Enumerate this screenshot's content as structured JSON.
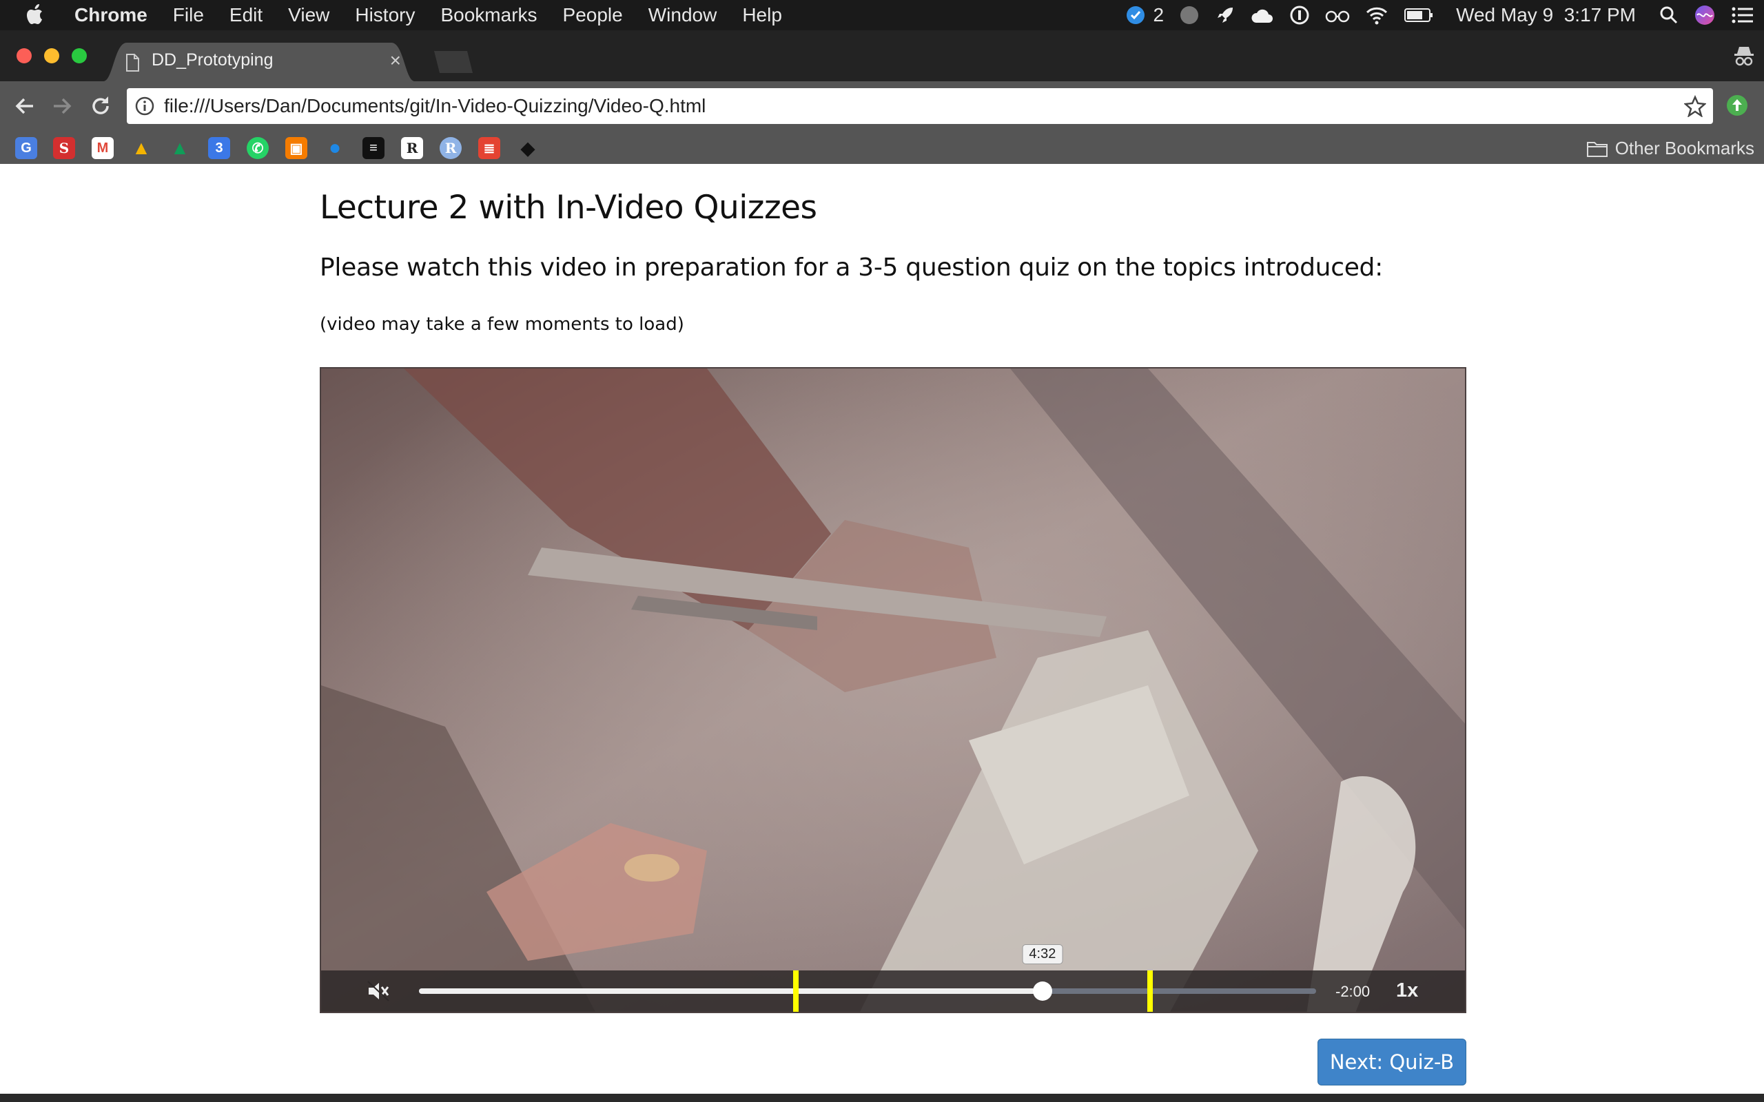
{
  "menubar": {
    "app_name": "Chrome",
    "menus": [
      "File",
      "Edit",
      "View",
      "History",
      "Bookmarks",
      "People",
      "Window",
      "Help"
    ],
    "notification_count": "2",
    "datetime": "Wed May 9  3:17 PM",
    "icons": [
      "apple-icon",
      "blue-badge-icon",
      "gray-dot-icon",
      "rocket-icon",
      "cloud-icon",
      "1password-icon",
      "glasses-icon",
      "wifi-icon",
      "battery-icon",
      "search-icon",
      "siri-icon",
      "menu-list-icon"
    ]
  },
  "tab": {
    "title": "DD_Prototyping",
    "close": "×"
  },
  "omnibox": {
    "url": "file:///Users/Dan/Documents/git/In-Video-Quizzing/Video-Q.html"
  },
  "bookmarks": {
    "items": [
      {
        "icon": "google-translate-icon",
        "glyph": "G",
        "color": "#4a7fe0"
      },
      {
        "icon": "s-bookmark-icon",
        "glyph": "S",
        "color": "#d32f2f"
      },
      {
        "icon": "gmail-icon",
        "glyph": "M",
        "color": "#e0483a"
      },
      {
        "icon": "google-drive-icon",
        "glyph": "▲",
        "color": "#f4b400"
      },
      {
        "icon": "google-drive-icon-2",
        "glyph": "▲",
        "color": "#0f9d58"
      },
      {
        "icon": "google-calendar-icon",
        "glyph": "3",
        "color": "#3b78e7"
      },
      {
        "icon": "whatsapp-icon",
        "glyph": "✆",
        "color": "#25d366"
      },
      {
        "icon": "orange-app-icon",
        "glyph": "▣",
        "color": "#f57c00"
      },
      {
        "icon": "blue-dot-icon",
        "glyph": "●",
        "color": "#1e88e5"
      },
      {
        "icon": "medium-icon",
        "glyph": "≡",
        "color": "#111111"
      },
      {
        "icon": "r-docs-icon",
        "glyph": "R",
        "color": "#ffffff"
      },
      {
        "icon": "r-circle-icon",
        "glyph": "R",
        "color": "#8fb3e6"
      },
      {
        "icon": "todoist-icon",
        "glyph": "≣",
        "color": "#e44332"
      },
      {
        "icon": "pen-nib-icon",
        "glyph": "◆",
        "color": "#222222"
      }
    ],
    "other_label": "Other Bookmarks"
  },
  "page": {
    "title": "Lecture 2 with In-Video Quizzes",
    "instructions": "Please watch this video in preparation for a 3-5 question quiz on the topics introduced:",
    "loading_note": "(video may take a few moments to load)",
    "next_button": "Next: Quiz-B"
  },
  "video": {
    "muted": true,
    "progress": 0.695,
    "quiz_markers": [
      0.42,
      0.815
    ],
    "hover_time": "4:32",
    "remaining": "-2:00",
    "speed": "1x"
  }
}
